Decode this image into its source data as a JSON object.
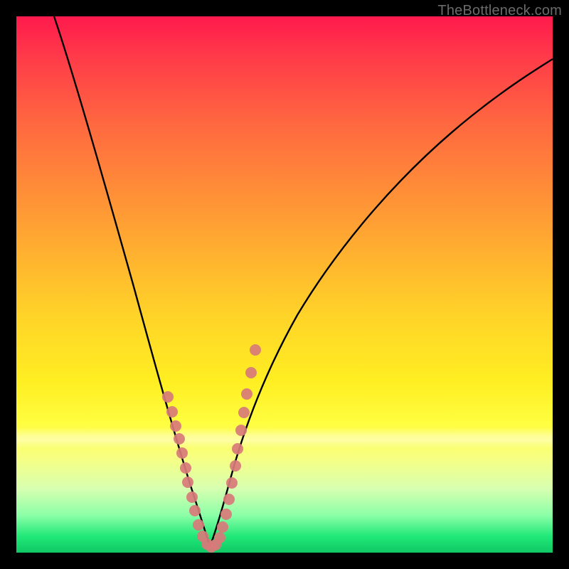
{
  "watermark": {
    "text": "TheBottleneck.com"
  },
  "chart_data": {
    "type": "line",
    "title": "",
    "xlabel": "",
    "ylabel": "",
    "xlim": [
      0,
      100
    ],
    "ylim": [
      0,
      100
    ],
    "grid": false,
    "legend": "none",
    "series": [
      {
        "name": "bottleneck-curve-left",
        "x": [
          7,
          10,
          14,
          18,
          22,
          25,
          28,
          30,
          32,
          33.5,
          35,
          36
        ],
        "y": [
          100,
          86,
          72,
          58,
          44,
          33,
          23,
          15,
          9,
          5,
          2,
          0.5
        ]
      },
      {
        "name": "bottleneck-curve-right",
        "x": [
          36,
          37,
          39,
          41.5,
          45,
          50,
          56,
          63,
          72,
          82,
          92,
          100
        ],
        "y": [
          0.5,
          3,
          9,
          18,
          28,
          40,
          50,
          59,
          68,
          76,
          83,
          88
        ]
      },
      {
        "name": "marker-dots",
        "type": "scatter",
        "color": "#d87a7a",
        "x": [
          28.2,
          29.0,
          29.7,
          30.3,
          30.9,
          31.5,
          32.0,
          32.7,
          33.3,
          34.0,
          34.8,
          35.6,
          36.4,
          37.2,
          37.9,
          38.5,
          39.1,
          39.6,
          40.2,
          40.8,
          41.3,
          41.9,
          42.5,
          43.0,
          43.8,
          44.6
        ],
        "y": [
          29.0,
          26.2,
          23.6,
          21.2,
          18.6,
          15.8,
          13.2,
          10.4,
          7.8,
          5.2,
          3.0,
          1.6,
          1.0,
          1.4,
          2.8,
          4.8,
          7.2,
          10.0,
          13.0,
          16.2,
          19.4,
          22.8,
          26.2,
          29.6,
          33.6,
          37.8
        ]
      }
    ]
  }
}
